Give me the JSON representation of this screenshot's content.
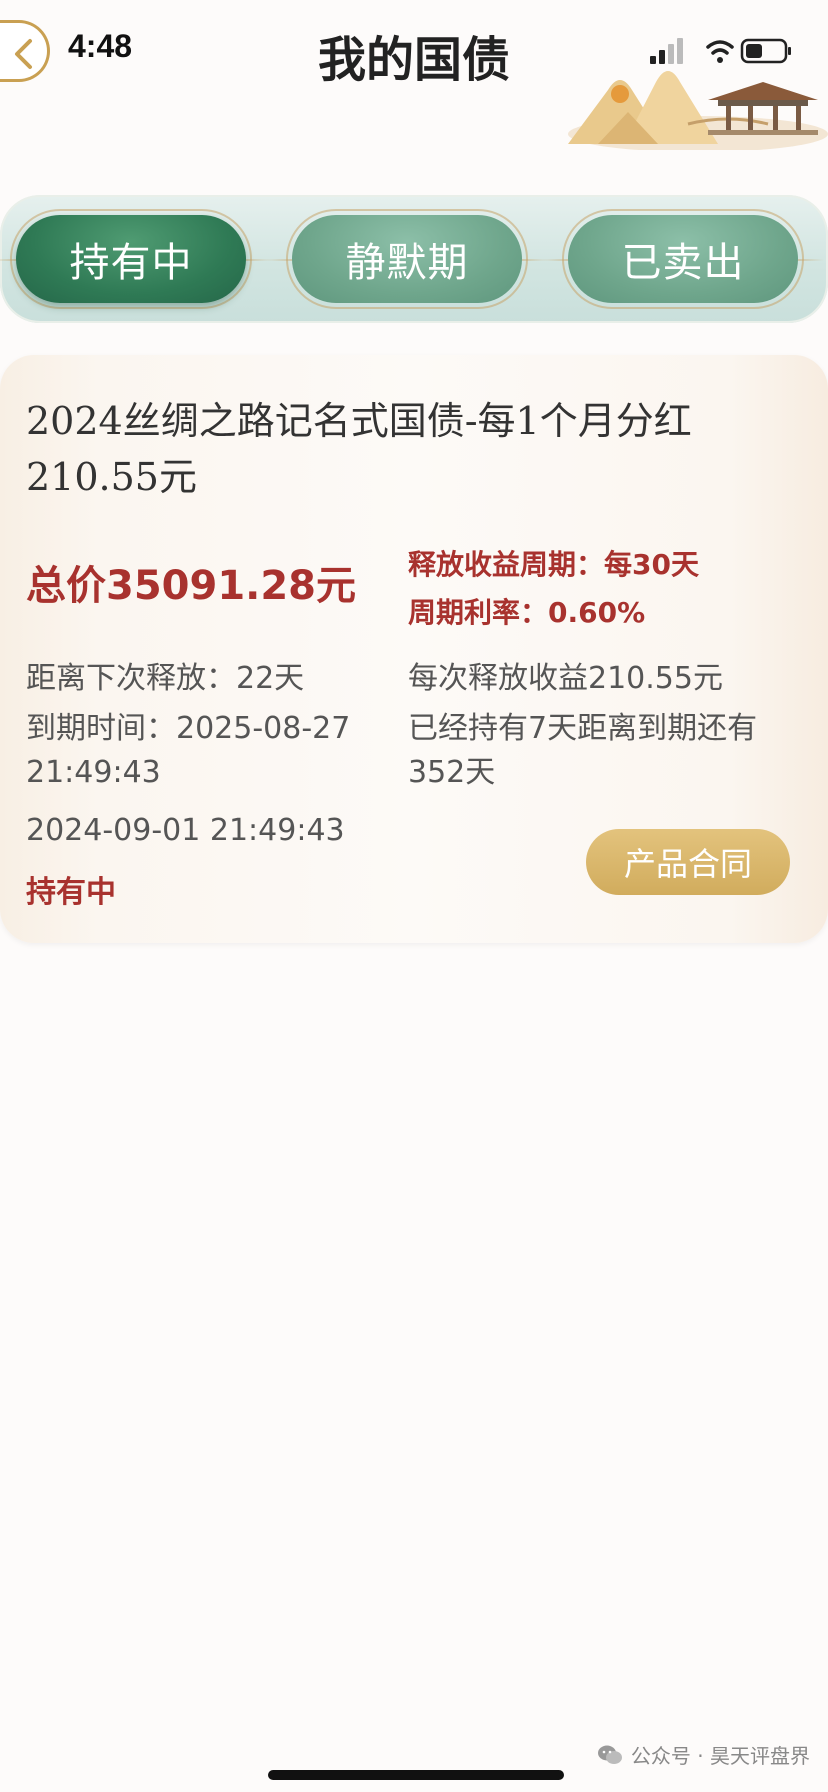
{
  "status_bar": {
    "time": "4:48"
  },
  "header": {
    "title": "我的国债"
  },
  "tabs": [
    {
      "label": "持有中",
      "active": true
    },
    {
      "label": "静默期",
      "active": false
    },
    {
      "label": "已卖出",
      "active": false
    }
  ],
  "card": {
    "title": "2024丝绸之路记名式国债-每1个月分红210.55元",
    "total_price": "总价35091.28元",
    "release_cycle": "释放收益周期：每30天",
    "cycle_rate": "周期利率：0.60%",
    "next_release": "距离下次释放：22天",
    "expire_time": "到期时间：2025-08-27 21:49:43",
    "per_release_income": "每次释放收益210.55元",
    "held_info": "已经持有7天距离到期还有352天",
    "purchase_time": "2024-09-01 21:49:43",
    "status": "持有中",
    "contract_button": "产品合同"
  },
  "watermark": {
    "text": "公众号 · 昊天评盘界"
  },
  "colors": {
    "accent_red": "#a8322e",
    "tab_green": "#2f7a55",
    "gold": "#d1ac5d"
  }
}
